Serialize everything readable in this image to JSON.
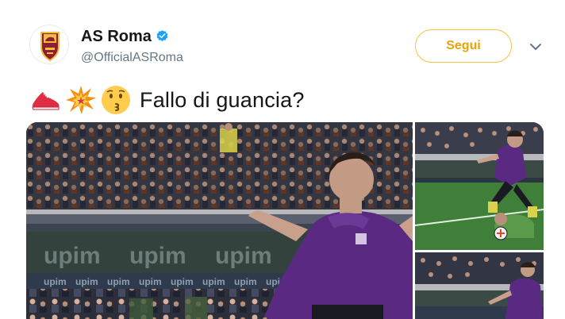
{
  "author": {
    "name": "AS Roma",
    "handle": "@OfficialASRoma",
    "avatar_icon": "as-roma-crest-icon",
    "verified_icon": "verified-badge-icon"
  },
  "actions": {
    "follow_label": "Segui",
    "more_icon": "chevron-down-icon"
  },
  "tweet": {
    "emojis": [
      "sneaker-emoji",
      "collision-emoji",
      "kissing-face-emoji"
    ],
    "text": "Fallo di guancia?"
  },
  "media": {
    "photos": [
      {
        "name": "football-photo-main"
      },
      {
        "name": "football-photo-side-1"
      },
      {
        "name": "football-photo-side-2"
      }
    ],
    "ad_board_text": "upim"
  },
  "colors": {
    "follow_border": "#f7c244",
    "follow_text": "#e9a20a",
    "verified": "#1da1f2",
    "roma_red": "#8e1f2f",
    "roma_yellow": "#f0bc42",
    "fiorentina_purple": "#5a2a82"
  }
}
